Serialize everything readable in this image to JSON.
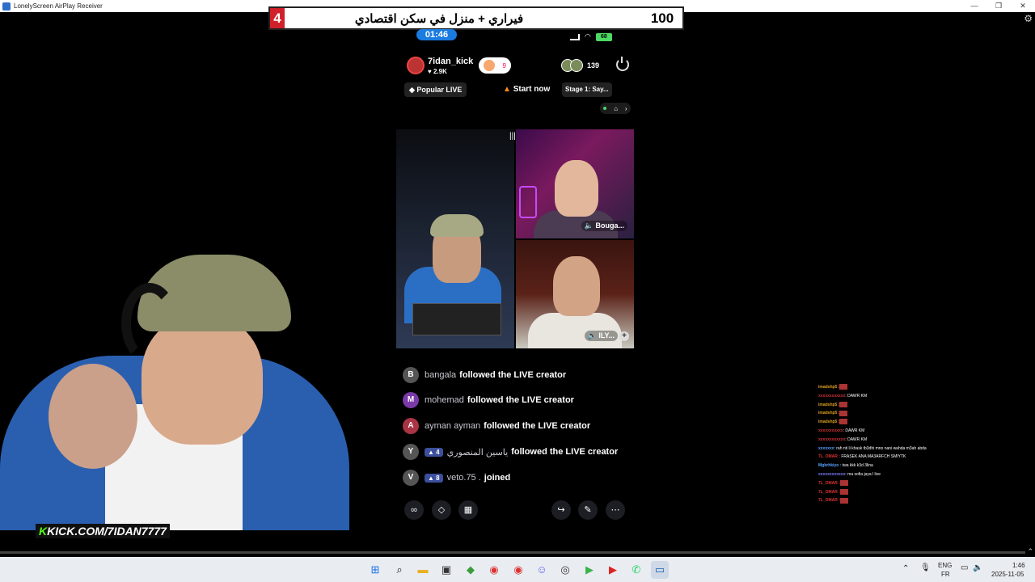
{
  "window": {
    "title": "LonelyScreen AirPlay Receiver",
    "controls": [
      "—",
      "❐",
      "✕"
    ]
  },
  "banner": {
    "left_number": "4",
    "title": "فيراري + منزل في سكن اقتصادي",
    "right_number": "100"
  },
  "phone_status": {
    "timer": "01:46",
    "battery": "68"
  },
  "host": {
    "name": "7idan_kick",
    "likes": "♥ 2.9K",
    "follow_count": "9",
    "viewer_count": "139"
  },
  "tags": {
    "popular": "Popular LIVE",
    "start": "Start now",
    "stage": "Stage 1: Say..."
  },
  "tiles": {
    "top_right_label": "Bouga...",
    "bottom_right_label": "ILY..."
  },
  "feed": [
    {
      "user": "bangala",
      "badge": "",
      "text": "followed the LIVE creator",
      "avatar": "B"
    },
    {
      "user": "mohemad",
      "badge": "",
      "text": "followed the LIVE creator",
      "avatar": "M"
    },
    {
      "user": "ayman ayman",
      "badge": "",
      "text": "followed the LIVE creator",
      "avatar": "A"
    },
    {
      "user": "ياسين المنصوري",
      "badge": "▲ 4",
      "text": "followed the LIVE creator",
      "avatar": "Y"
    },
    {
      "user": "veto.75 .",
      "badge": "▲ 8",
      "text": "joined",
      "avatar": "V"
    }
  ],
  "stream_overlay": {
    "kick_k": "K",
    "kick_url": "KICK.COM/7IDAN7777"
  },
  "chat": [
    {
      "user": "imadshp5 :",
      "msg": ""
    },
    {
      "user": "",
      "msg": ": DAWR KM"
    },
    {
      "user": "imadshp5 :",
      "msg": ""
    },
    {
      "user": "imadshp5 :",
      "msg": ""
    },
    {
      "user": "imadshp5 :",
      "msg": ""
    },
    {
      "user": "",
      "msg": ": DAWR KM"
    },
    {
      "user": "",
      "msg": ": DAWR KM"
    },
    {
      "user": "",
      "msg": ": rah nti li khask tb3dhi mno nani wahda m3ah abda"
    },
    {
      "user": "7L_OMAR :",
      "msg": "FRASEK ANA MA3ARFCH SMIYTK"
    },
    {
      "user": "Mgbrhkiyo :",
      "msg": "twa kkk k3d 3lina"
    },
    {
      "user": "",
      "msg": ": ma sofia jaya l live"
    },
    {
      "user": "7L_OMAR :",
      "msg": ""
    },
    {
      "user": "7L_OMAR :",
      "msg": ""
    },
    {
      "user": "7L_OMAR :",
      "msg": ""
    }
  ],
  "taskbar": {
    "lang_top": "ENG",
    "lang_bottom": "FR",
    "time": "1:46",
    "date": "2025-11-05"
  },
  "colors": {
    "accent_blue": "#1a7be0",
    "kick_green": "#53fc18",
    "banner_red": "#d0202a",
    "taskbar_bg": "#e9ecf1"
  }
}
